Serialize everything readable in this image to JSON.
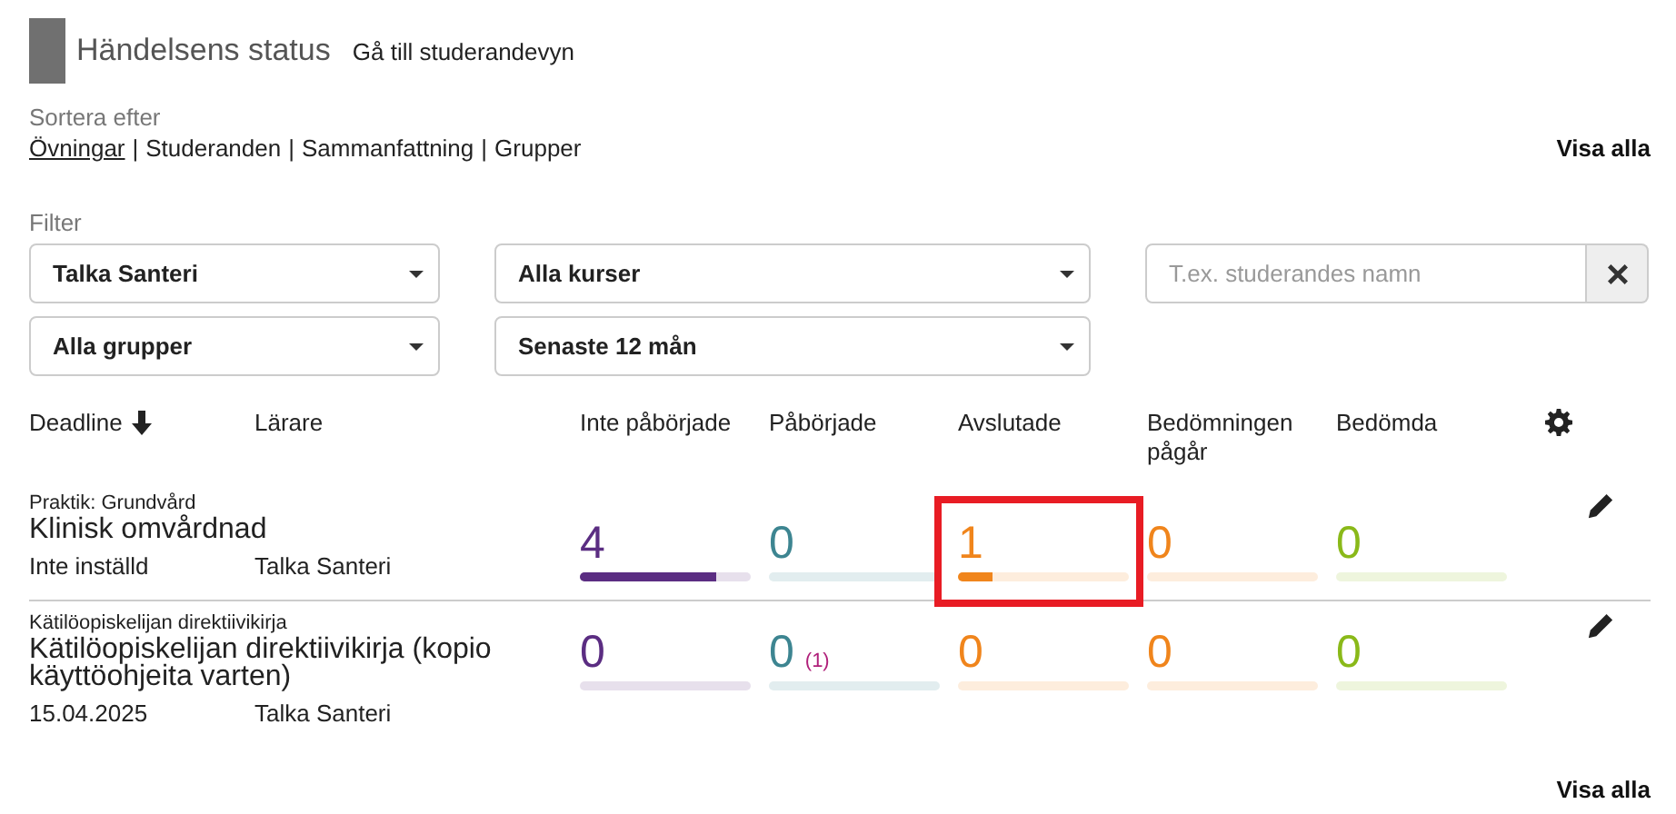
{
  "header": {
    "title": "Händelsens status",
    "link": "Gå till studerandevyn"
  },
  "sort": {
    "label": "Sortera efter",
    "options": [
      {
        "label": "Övningar",
        "selected": true
      },
      {
        "label": "Studeranden",
        "selected": false
      },
      {
        "label": "Sammanfattning",
        "selected": false
      },
      {
        "label": "Grupper",
        "selected": false
      }
    ],
    "separator": "|",
    "show_all": "Visa alla"
  },
  "filter": {
    "label": "Filter",
    "dropdowns": [
      {
        "value": "Talka Santeri"
      },
      {
        "value": "Alla kurser"
      },
      {
        "value": "Alla grupper"
      },
      {
        "value": "Senaste 12 mån"
      }
    ],
    "search": {
      "placeholder": "T.ex. studerandes namn"
    }
  },
  "table": {
    "columns": [
      {
        "label": "Deadline"
      },
      {
        "label": "Lärare"
      }
    ],
    "status_columns": [
      {
        "label": "Inte påbörjade",
        "color": "#5b2d82"
      },
      {
        "label": "Påbörjade",
        "color": "#3d8591"
      },
      {
        "label": "Avslutade",
        "color": "#f0851c"
      },
      {
        "label": "Bedömningen pågår",
        "color": "#f0851c"
      },
      {
        "label": "Bedömda",
        "color": "#8ab919"
      }
    ],
    "rows": [
      {
        "course": "Praktik: Grundvård",
        "title": "Klinisk omvårdnad",
        "deadline": "Inte inställd",
        "teacher": "Talka Santeri",
        "counts": [
          {
            "value": "4",
            "level": 0.8,
            "highlighted": false
          },
          {
            "value": "0",
            "level": 0,
            "highlighted": false
          },
          {
            "value": "1",
            "level": 0.2,
            "highlighted": true
          },
          {
            "value": "0",
            "level": 0,
            "highlighted": false
          },
          {
            "value": "0",
            "level": 0,
            "highlighted": false
          }
        ]
      },
      {
        "course": "Kätilöopiskelijan direktiivikirja",
        "title": "Kätilöopiskelijan direktiivikirja (kopio käyttöohjeita varten)",
        "deadline": "15.04.2025",
        "teacher": "Talka Santeri",
        "counts": [
          {
            "value": "0",
            "level": 0,
            "highlighted": false
          },
          {
            "value": "0",
            "extra": "(1)",
            "level": 0,
            "highlighted": false
          },
          {
            "value": "0",
            "level": 0,
            "highlighted": false
          },
          {
            "value": "0",
            "level": 0,
            "highlighted": false
          },
          {
            "value": "0",
            "level": 0,
            "highlighted": false
          }
        ]
      }
    ]
  },
  "footer": {
    "show_all": "Visa alla"
  }
}
